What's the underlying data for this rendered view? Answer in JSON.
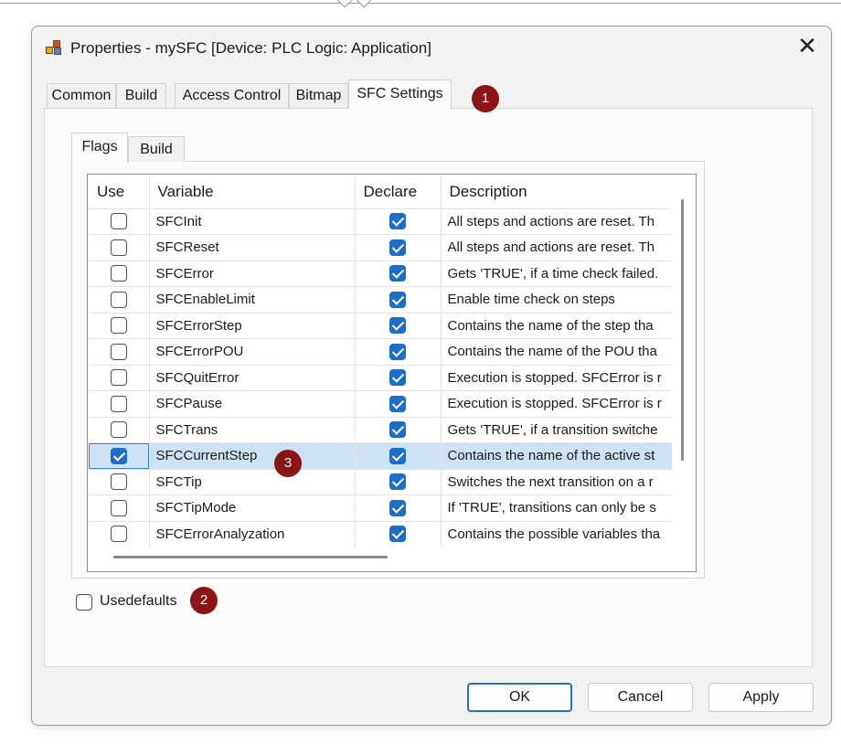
{
  "window": {
    "title": "Properties - mySFC [Device: PLC Logic: Application]",
    "close_glyph": "✕"
  },
  "tabs": [
    {
      "label": "Common"
    },
    {
      "label": "Build"
    },
    {
      "label": "Access Control"
    },
    {
      "label": "Bitmap"
    },
    {
      "label": "SFC Settings",
      "active": true
    }
  ],
  "subtabs": [
    {
      "label": "Flags",
      "active": true
    },
    {
      "label": "Build"
    }
  ],
  "grid": {
    "columns": [
      "Use",
      "Variable",
      "Declare",
      "Description"
    ],
    "rows": [
      {
        "use": false,
        "variable": "SFCInit",
        "declare": true,
        "description": "All steps and actions are reset. Th"
      },
      {
        "use": false,
        "variable": "SFCReset",
        "declare": true,
        "description": "All steps and actions are reset. Th"
      },
      {
        "use": false,
        "variable": "SFCError",
        "declare": true,
        "description": "Gets 'TRUE', if a time check failed."
      },
      {
        "use": false,
        "variable": "SFCEnableLimit",
        "declare": true,
        "description": "Enable time check on steps"
      },
      {
        "use": false,
        "variable": "SFCErrorStep",
        "declare": true,
        "description": "Contains the name of the step tha"
      },
      {
        "use": false,
        "variable": "SFCErrorPOU",
        "declare": true,
        "description": "Contains the name of the POU tha"
      },
      {
        "use": false,
        "variable": "SFCQuitError",
        "declare": true,
        "description": "Execution is stopped. SFCError is r"
      },
      {
        "use": false,
        "variable": "SFCPause",
        "declare": true,
        "description": "Execution is stopped. SFCError is r"
      },
      {
        "use": false,
        "variable": "SFCTrans",
        "declare": true,
        "description": "Gets 'TRUE', if a transition switche"
      },
      {
        "use": true,
        "variable": "SFCCurrentStep",
        "declare": true,
        "description": "Contains the name of the active st",
        "selected": true
      },
      {
        "use": false,
        "variable": "SFCTip",
        "declare": true,
        "description": "Switches the next transition on a r"
      },
      {
        "use": false,
        "variable": "SFCTipMode",
        "declare": true,
        "description": "If 'TRUE', transitions can only be s"
      },
      {
        "use": false,
        "variable": "SFCErrorAnalyzation",
        "declare": true,
        "description": "Contains the possible variables tha"
      }
    ]
  },
  "use_defaults": {
    "label": "Usedefaults",
    "checked": false
  },
  "badges": [
    "1",
    "2",
    "3"
  ],
  "buttons": {
    "ok": "OK",
    "cancel": "Cancel",
    "apply": "Apply"
  },
  "colors": {
    "accent": "#1d6ec8",
    "selection": "#cde3f5",
    "badge": "#8b1414"
  }
}
